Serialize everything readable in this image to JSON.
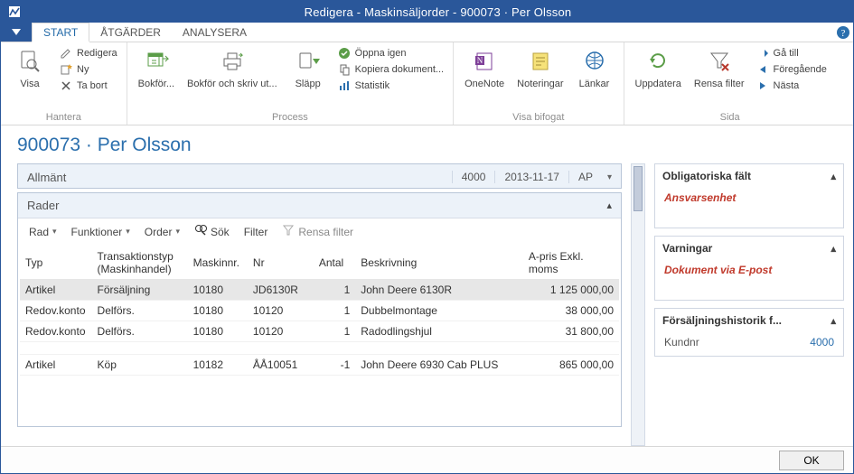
{
  "window": {
    "title": "Redigera - Maskinsäljorder - 900073 · Per Olsson"
  },
  "tabs": {
    "start": "START",
    "actions": "ÅTGÄRDER",
    "analyze": "ANALYSERA"
  },
  "ribbon": {
    "groups": {
      "hantera": {
        "caption": "Hantera",
        "visa": "Visa",
        "edit": "Redigera",
        "new": "Ny",
        "delete": "Ta bort"
      },
      "process": {
        "caption": "Process",
        "bokfor": "Bokför...",
        "bokfor_skriv": "Bokför och skriv ut...",
        "slapp": "Släpp",
        "oppna": "Öppna igen",
        "kopiera": "Kopiera dokument...",
        "statistik": "Statistik"
      },
      "bifogat": {
        "caption": "Visa bifogat",
        "onenote": "OneNote",
        "noteringar": "Noteringar",
        "lankar": "Länkar"
      },
      "sida": {
        "caption": "Sida",
        "uppdatera": "Uppdatera",
        "rensa": "Rensa filter",
        "gatill": "Gå till",
        "foregaende": "Föregående",
        "nasta": "Nästa"
      }
    }
  },
  "doc": {
    "title": "900073 · Per Olsson"
  },
  "fasttabs": {
    "allmant": {
      "label": "Allmänt",
      "f1": "4000",
      "f2": "2013-11-17",
      "f3": "AP"
    },
    "rader": {
      "label": "Rader"
    }
  },
  "lines_toolbar": {
    "rad": "Rad",
    "funktioner": "Funktioner",
    "order": "Order",
    "sok": "Sök",
    "filter": "Filter",
    "rensa": "Rensa filter"
  },
  "columns": {
    "typ": "Typ",
    "trans": "Transaktionstyp (Maskinhandel)",
    "maskinnr": "Maskinnr.",
    "nr": "Nr",
    "antal": "Antal",
    "beskrivning": "Beskrivning",
    "apris": "A-pris Exkl. moms"
  },
  "rows": [
    {
      "typ": "Artikel",
      "trans": "Försäljning",
      "maskinnr": "10180",
      "nr": "JD6130R",
      "antal": "1",
      "besk": "John Deere 6130R",
      "apris": "1 125 000,00",
      "sel": true
    },
    {
      "typ": "Redov.konto",
      "trans": "Delförs.",
      "maskinnr": "10180",
      "nr": "10120",
      "antal": "1",
      "besk": "Dubbelmontage",
      "apris": "38 000,00"
    },
    {
      "typ": "Redov.konto",
      "trans": "Delförs.",
      "maskinnr": "10180",
      "nr": "10120",
      "antal": "1",
      "besk": "Radodlingshjul",
      "apris": "31 800,00"
    },
    {
      "spacer": true
    },
    {
      "typ": "Artikel",
      "trans": "Köp",
      "maskinnr": "10182",
      "nr": "ÅÅ10051",
      "antal": "-1",
      "besk": "John Deere 6930 Cab PLUS",
      "apris": "865 000,00"
    }
  ],
  "right": {
    "p1": {
      "title": "Obligatoriska fält",
      "line": "Ansvarsenhet"
    },
    "p2": {
      "title": "Varningar",
      "line": "Dokument via E-post"
    },
    "p3": {
      "title": "Försäljningshistorik f...",
      "link": "4000",
      "label": "Kundnr"
    }
  },
  "footer": {
    "ok": "OK"
  }
}
